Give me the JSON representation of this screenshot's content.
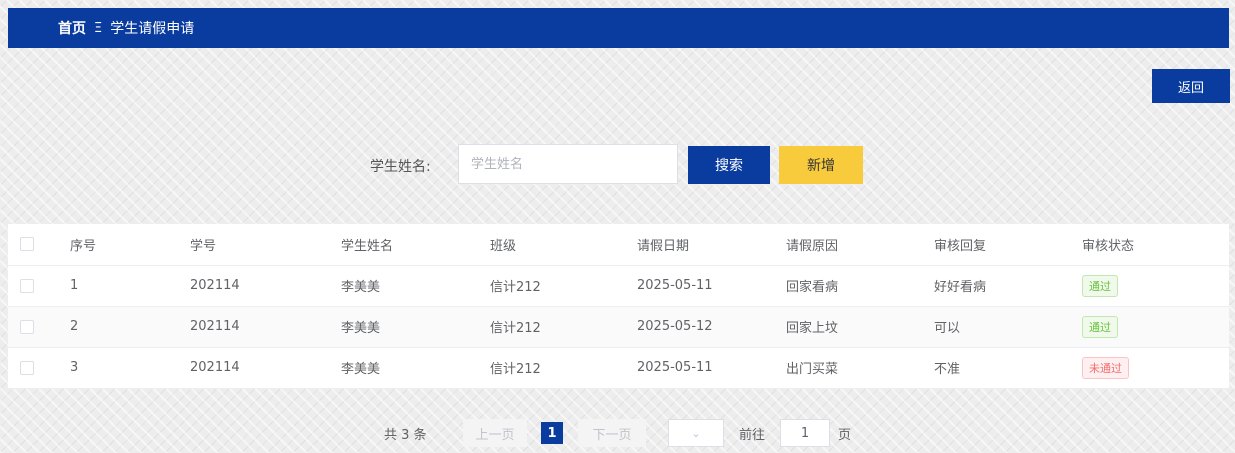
{
  "breadcrumb": {
    "home": "首页",
    "separator": "Ξ",
    "current": "学生请假申请"
  },
  "toolbar": {
    "back_label": "返回"
  },
  "search": {
    "label": "学生姓名:",
    "placeholder": "学生姓名",
    "value": "",
    "search_label": "搜索",
    "add_label": "新增"
  },
  "table": {
    "headers": [
      "序号",
      "学号",
      "学生姓名",
      "班级",
      "请假日期",
      "请假原因",
      "审核回复",
      "审核状态"
    ],
    "rows": [
      {
        "idx": "1",
        "sno": "202114",
        "name": "李美美",
        "cls": "信计212",
        "date": "2025-05-11",
        "reason": "回家看病",
        "reply": "好好看病",
        "status": "通过"
      },
      {
        "idx": "2",
        "sno": "202114",
        "name": "李美美",
        "cls": "信计212",
        "date": "2025-05-12",
        "reason": "回家上坟",
        "reply": "可以",
        "status": "通过"
      },
      {
        "idx": "3",
        "sno": "202114",
        "name": "李美美",
        "cls": "信计212",
        "date": "2025-05-11",
        "reason": "出门买菜",
        "reply": "不准",
        "status": "未通过"
      }
    ]
  },
  "pagination": {
    "total_text": "共 3 条",
    "prev_label": "上一页",
    "current_page": "1",
    "next_label": "下一页",
    "size_chevron": "⌄",
    "goto_label": "前往",
    "jump_value": "1",
    "page_unit": "页"
  },
  "colors": {
    "primary": "#0a3ca0",
    "accent": "#f8cb3d",
    "pass": "#67c23a",
    "fail": "#f56c6c"
  }
}
